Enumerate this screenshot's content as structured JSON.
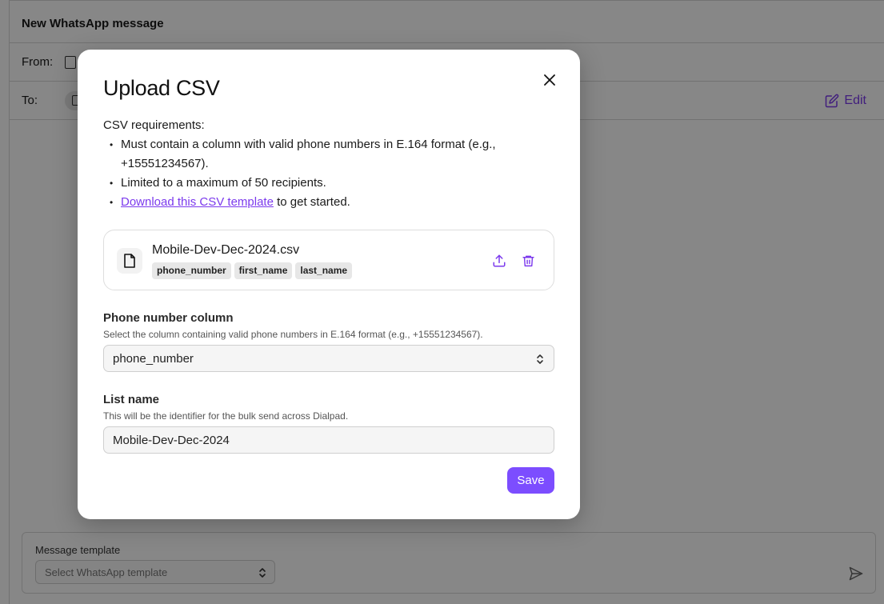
{
  "background": {
    "header": {
      "title": "New WhatsApp message"
    },
    "from_label": "From:",
    "to_label": "To:",
    "edit_label": "Edit",
    "composer": {
      "label": "Message template",
      "select_placeholder": "Select WhatsApp template"
    }
  },
  "modal": {
    "title": "Upload CSV",
    "requirements_heading": "CSV requirements:",
    "requirements": [
      "Must contain a column with valid phone numbers in E.164 format (e.g., +15551234567).",
      "Limited to a maximum of 50 recipients."
    ],
    "download_link": "Download this CSV template",
    "download_suffix": " to get started.",
    "file": {
      "name": "Mobile-Dev-Dec-2024.csv",
      "columns": [
        "phone_number",
        "first_name",
        "last_name"
      ]
    },
    "phone_column": {
      "label": "Phone number column",
      "help": "Select the column containing valid phone numbers in E.164 format (e.g., +15551234567).",
      "value": "phone_number"
    },
    "list_name": {
      "label": "List name",
      "help": "This will be the identifier for the bulk send across Dialpad.",
      "value": "Mobile-Dev-Dec-2024"
    },
    "save_label": "Save"
  },
  "colors": {
    "accent": "#7c4dff",
    "link": "#7c3aed",
    "overlay": "rgba(0,0,0,0.47)"
  },
  "icons": [
    "device-icon",
    "contact-icon",
    "edit-icon",
    "chevron-updown-icon",
    "send-icon",
    "close-icon",
    "file-icon",
    "upload-icon",
    "trash-icon"
  ]
}
